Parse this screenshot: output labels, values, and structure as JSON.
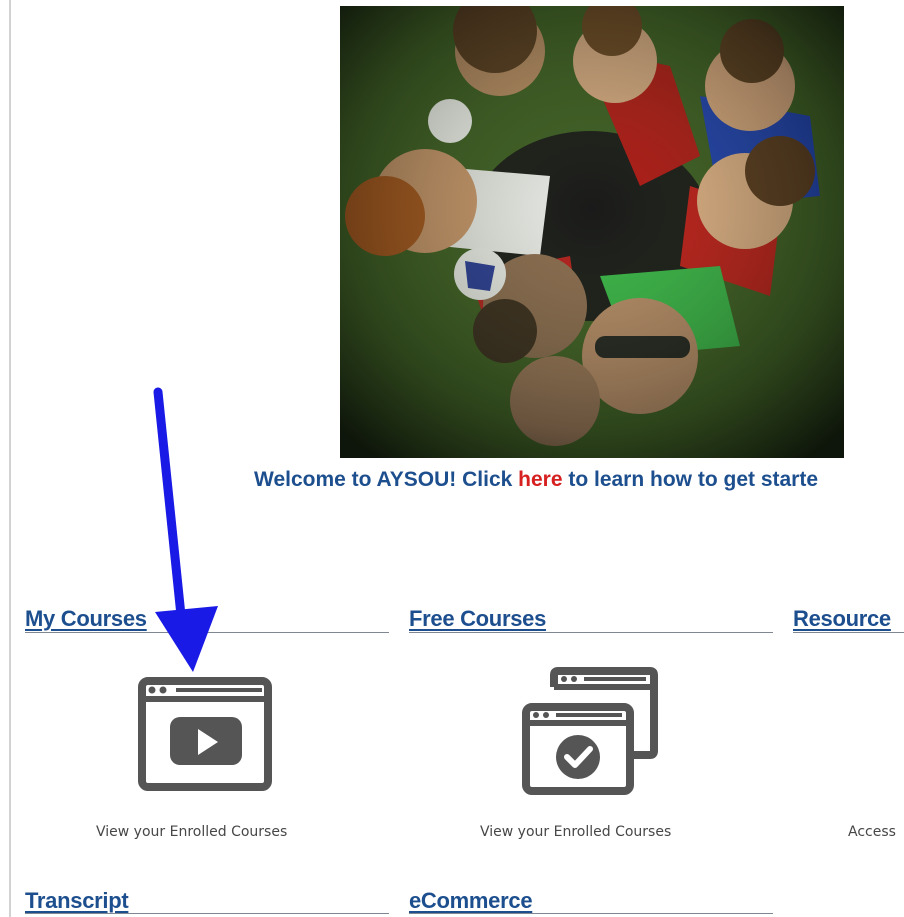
{
  "welcome": {
    "text_before": "Welcome to AYSOU! Click ",
    "link_text": "here",
    "text_after": " to learn how to get starte"
  },
  "sections": {
    "my_courses": {
      "title": "My Courses",
      "caption": "View your Enrolled Courses",
      "icon": "video-play-window-icon"
    },
    "free_courses": {
      "title": "Free Courses",
      "caption": "View your Enrolled Courses",
      "icon": "stacked-windows-check-icon"
    },
    "resources": {
      "title": "Resource",
      "caption": "Access"
    },
    "transcript": {
      "title": "Transcript"
    },
    "ecommerce": {
      "title": "eCommerce"
    }
  },
  "colors": {
    "heading_blue": "#1d4f8f",
    "link_red": "#d72020",
    "icon_gray": "#555555",
    "arrow_blue": "#1a1ae6"
  }
}
